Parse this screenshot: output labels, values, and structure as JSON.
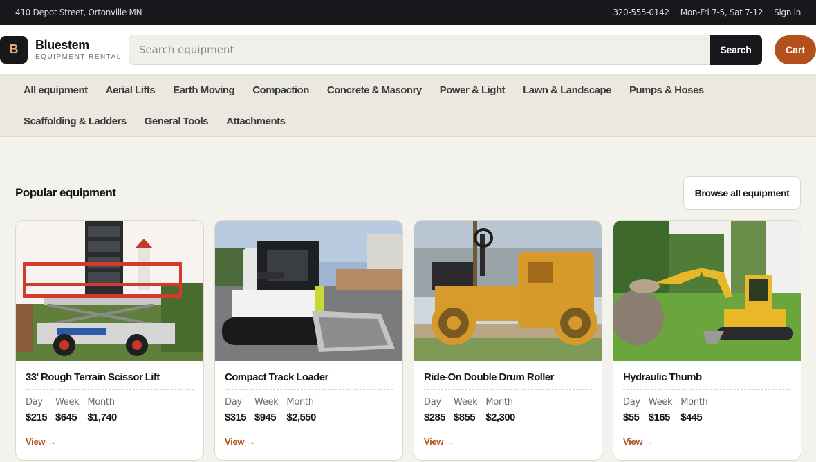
{
  "topbar": {
    "address": "410 Depot Street, Ortonville MN",
    "phone": "320-555-0142",
    "hours": "Mon-Fri 7-5, Sat 7-12",
    "signin": "Sign in"
  },
  "header": {
    "logo_letter": "B",
    "brand_name": "Bluestem",
    "brand_tagline": "EQUIPMENT RENTAL",
    "search_placeholder": "Search equipment",
    "search_label": "Search",
    "cart_label": "Cart"
  },
  "nav": {
    "items": [
      "All equipment",
      "Aerial Lifts",
      "Earth Moving",
      "Compaction",
      "Concrete & Masonry",
      "Power & Light",
      "Lawn & Landscape",
      "Pumps & Hoses",
      "Scaffolding & Ladders",
      "General Tools",
      "Attachments"
    ]
  },
  "section": {
    "title": "Popular equipment",
    "browse_label": "Browse all equipment"
  },
  "price_labels": {
    "day": "Day",
    "week": "Week",
    "month": "Month"
  },
  "cards": [
    {
      "title": "33' Rough Terrain Scissor Lift",
      "day": "$215",
      "week": "$645",
      "month": "$1,740",
      "link": "View →"
    },
    {
      "title": "Compact Track Loader",
      "day": "$315",
      "week": "$945",
      "month": "$2,550",
      "link": "View →"
    },
    {
      "title": "Ride-On Double Drum Roller",
      "day": "$285",
      "week": "$855",
      "month": "$2,300",
      "link": "View →"
    },
    {
      "title": "Hydraulic Thumb",
      "day": "$55",
      "week": "$165",
      "month": "$445",
      "link": "View →"
    }
  ],
  "colors": {
    "dark": "#16181c",
    "accent": "#b4501e",
    "background": "#f4f2ec",
    "nav_bg": "#ebe8df"
  }
}
